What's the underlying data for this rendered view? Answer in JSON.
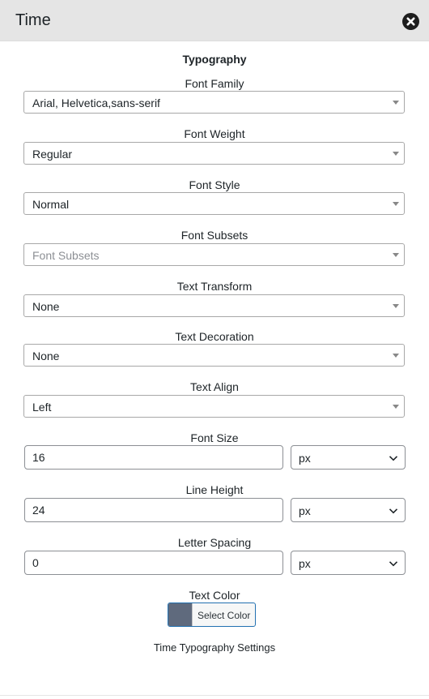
{
  "header": {
    "title": "Time"
  },
  "section_title": "Typography",
  "fields": {
    "font_family": {
      "label": "Font Family",
      "value": "Arial, Helvetica,sans-serif"
    },
    "font_weight": {
      "label": "Font Weight",
      "value": "Regular"
    },
    "font_style": {
      "label": "Font Style",
      "value": "Normal"
    },
    "font_subsets": {
      "label": "Font Subsets",
      "placeholder": "Font Subsets"
    },
    "text_transform": {
      "label": "Text Transform",
      "value": "None"
    },
    "text_decoration": {
      "label": "Text Decoration",
      "value": "None"
    },
    "text_align": {
      "label": "Text Align",
      "value": "Left"
    },
    "font_size": {
      "label": "Font Size",
      "value": "16",
      "unit": "px"
    },
    "line_height": {
      "label": "Line Height",
      "value": "24",
      "unit": "px"
    },
    "letter_spacing": {
      "label": "Letter Spacing",
      "value": "0",
      "unit": "px"
    },
    "text_color": {
      "label": "Text Color",
      "button_label": "Select Color",
      "swatch_color": "#5f6a7d"
    }
  },
  "footer": {
    "description": "Time Typography Settings"
  },
  "icons": {
    "close": "close-circle-icon",
    "dropdown": "caret-down-icon",
    "chevron": "chevron-down-icon"
  }
}
